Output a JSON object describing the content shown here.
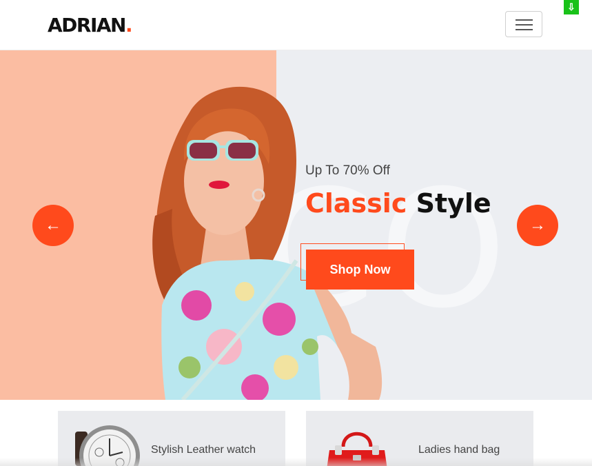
{
  "header": {
    "logo_text": "ADRIAN",
    "logo_dot": ".",
    "menu_icon": "hamburger-icon",
    "download_icon": "download-arrow-icon",
    "download_glyph": "⇩"
  },
  "hero": {
    "subtitle": "Up To 70% Off",
    "title_accent": "Classic",
    "title_rest": "Style",
    "background_letters": "CO",
    "cta_label": "Shop Now",
    "prev_icon": "arrow-left-icon",
    "next_icon": "arrow-right-icon",
    "prev_glyph": "←",
    "next_glyph": "→"
  },
  "products": [
    {
      "name": "Stylish Leather watch",
      "image_icon": "watch-icon"
    },
    {
      "name": "Ladies hand bag",
      "image_icon": "handbag-icon"
    }
  ],
  "colors": {
    "accent": "#ff4a1c",
    "hero_left_bg": "#fbbda2",
    "hero_right_bg": "#eceef2",
    "download_badge": "#19c219"
  }
}
